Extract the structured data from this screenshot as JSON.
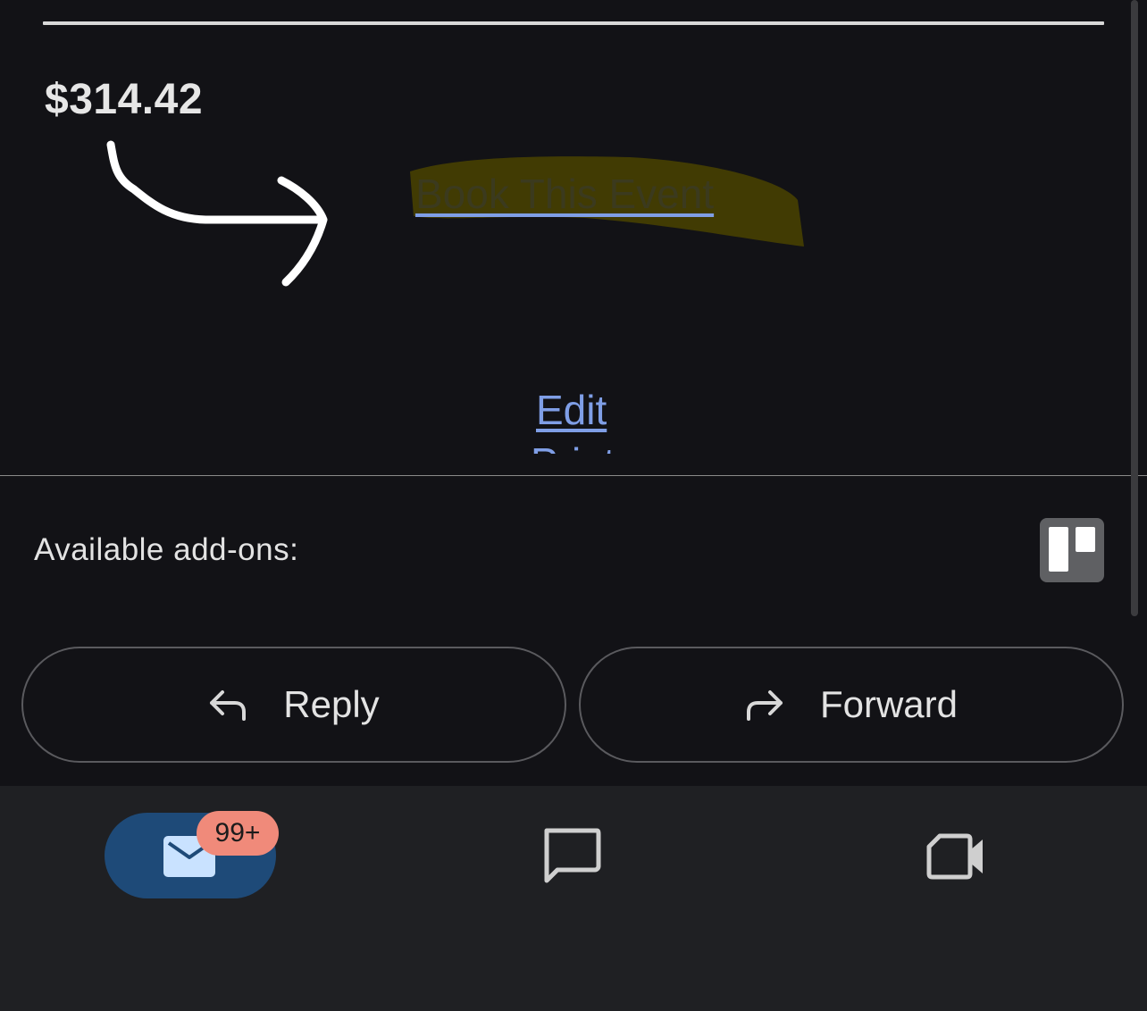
{
  "email": {
    "price": "$314.42",
    "book_link": "Book This Event",
    "edit_link": "Edit",
    "print_link": "Print"
  },
  "addons": {
    "label": "Available add-ons:",
    "addon_icon": "trello-icon"
  },
  "actions": {
    "reply_label": "Reply",
    "forward_label": "Forward",
    "reply_icon": "reply-arrow-icon",
    "forward_icon": "forward-arrow-icon"
  },
  "bottom_nav": {
    "mail_badge": "99+",
    "items": [
      "mail-icon",
      "chat-icon",
      "meet-video-icon"
    ],
    "active": "mail"
  },
  "colors": {
    "background": "#121216",
    "link": "#7f9ee6",
    "highlight": "#4a4300",
    "nav_active": "#1e4a78",
    "badge": "#f08a7a"
  }
}
